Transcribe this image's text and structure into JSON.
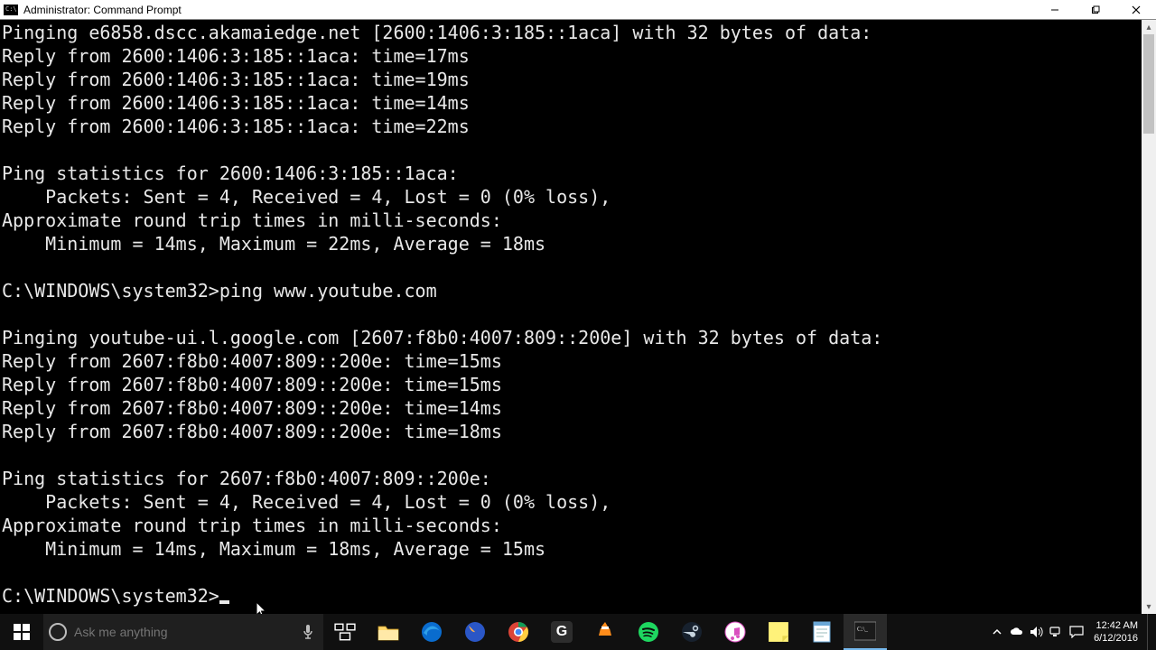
{
  "window": {
    "title": "Administrator: Command Prompt"
  },
  "terminal": {
    "lines": [
      "Pinging e6858.dscc.akamaiedge.net [2600:1406:3:185::1aca] with 32 bytes of data:",
      "Reply from 2600:1406:3:185::1aca: time=17ms",
      "Reply from 2600:1406:3:185::1aca: time=19ms",
      "Reply from 2600:1406:3:185::1aca: time=14ms",
      "Reply from 2600:1406:3:185::1aca: time=22ms",
      "",
      "Ping statistics for 2600:1406:3:185::1aca:",
      "    Packets: Sent = 4, Received = 4, Lost = 0 (0% loss),",
      "Approximate round trip times in milli-seconds:",
      "    Minimum = 14ms, Maximum = 22ms, Average = 18ms",
      "",
      "C:\\WINDOWS\\system32>ping www.youtube.com",
      "",
      "Pinging youtube-ui.l.google.com [2607:f8b0:4007:809::200e] with 32 bytes of data:",
      "Reply from 2607:f8b0:4007:809::200e: time=15ms",
      "Reply from 2607:f8b0:4007:809::200e: time=15ms",
      "Reply from 2607:f8b0:4007:809::200e: time=14ms",
      "Reply from 2607:f8b0:4007:809::200e: time=18ms",
      "",
      "Ping statistics for 2607:f8b0:4007:809::200e:",
      "    Packets: Sent = 4, Received = 4, Lost = 0 (0% loss),",
      "Approximate round trip times in milli-seconds:",
      "    Minimum = 14ms, Maximum = 18ms, Average = 15ms",
      ""
    ],
    "prompt": "C:\\WINDOWS\\system32>"
  },
  "taskbar": {
    "search_placeholder": "Ask me anything",
    "clock_time": "12:42 AM",
    "clock_date": "6/12/2016",
    "apps": [
      {
        "name": "task-view"
      },
      {
        "name": "file-explorer"
      },
      {
        "name": "edge"
      },
      {
        "name": "firefox"
      },
      {
        "name": "chrome"
      },
      {
        "name": "grammarly"
      },
      {
        "name": "vlc"
      },
      {
        "name": "spotify"
      },
      {
        "name": "steam"
      },
      {
        "name": "itunes"
      },
      {
        "name": "sticky-notes"
      },
      {
        "name": "notepad"
      },
      {
        "name": "cmd",
        "active": true
      }
    ]
  }
}
